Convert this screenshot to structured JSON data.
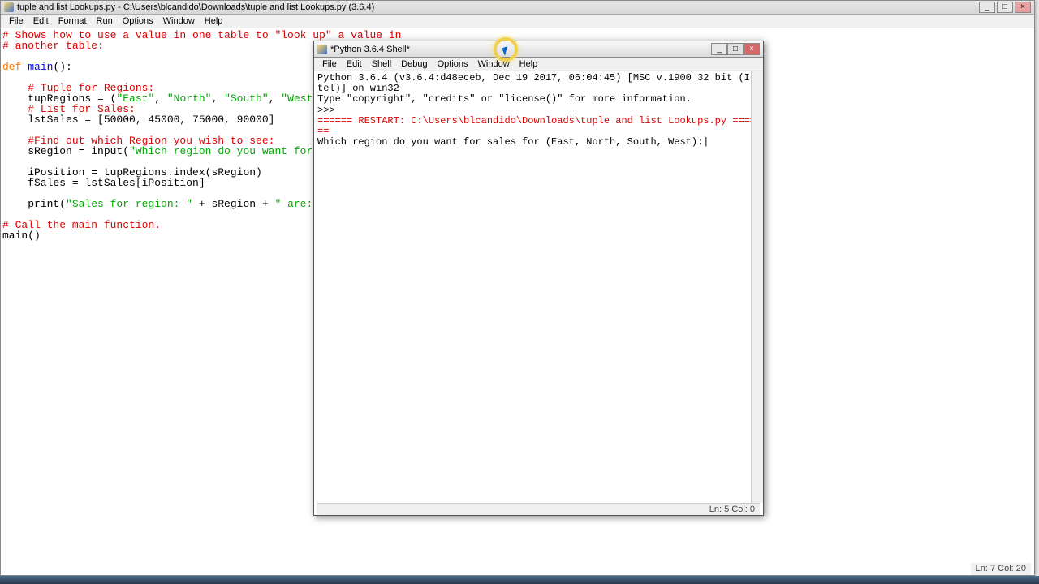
{
  "main_window": {
    "title": "tuple and list Lookups.py - C:\\Users\\blcandido\\Downloads\\tuple and list Lookups.py (3.6.4)",
    "menu": [
      "File",
      "Edit",
      "Format",
      "Run",
      "Options",
      "Window",
      "Help"
    ],
    "status": "Ln: 7   Col: 20",
    "code": {
      "l1": "# Shows how to use a value in one table to \"look up\" a value in",
      "l2": "# another table:",
      "l3": "",
      "l4a": "def",
      "l4b": " main():",
      "l4c": "main",
      "l5": "",
      "l6": "    # Tuple for Regions:",
      "l7a": "    tupRegions = (",
      "l7b": "\"East\"",
      "l7c": ", ",
      "l7d": "\"North\"",
      "l7e": ", ",
      "l7f": "\"South\"",
      "l7g": ", ",
      "l7h": "\"West\"",
      "l7i": ")",
      "l8": "    # List for Sales:",
      "l9": "    lstSales = [50000, 45000, 75000, 90000]",
      "l10": "",
      "l11": "    #Find out which Region you wish to see:",
      "l12a": "    sRegion = input(",
      "l12b": "\"Which region do you want for sales f",
      "l13": "",
      "l14": "    iPosition = tupRegions.index(sRegion)",
      "l15": "    fSales = lstSales[iPosition]",
      "l16": "",
      "l17a": "    print(",
      "l17b": "\"Sales for region: \"",
      "l17c": " + sRegion + ",
      "l17d": "\" are: $\"",
      "l17e": " + '",
      "l18": "",
      "l19": "# Call the main function.",
      "l20": "main()"
    }
  },
  "shell_window": {
    "title": "*Python 3.6.4 Shell*",
    "menu": [
      "File",
      "Edit",
      "Shell",
      "Debug",
      "Options",
      "Window",
      "Help"
    ],
    "status": "Ln: 5   Col: 0",
    "lines": {
      "l1": "Python 3.6.4 (v3.6.4:d48eceb, Dec 19 2017, 06:04:45) [MSC v.1900 32 bit (Intel)] on win32",
      "l2": "Type \"copyright\", \"credits\" or \"license()\" for more information.",
      "l3": ">>> ",
      "l4": "====== RESTART: C:\\Users\\blcandido\\Downloads\\tuple and list Lookups.py ======",
      "l5": "Which region do you want for sales for (East, North, South, West):"
    }
  }
}
